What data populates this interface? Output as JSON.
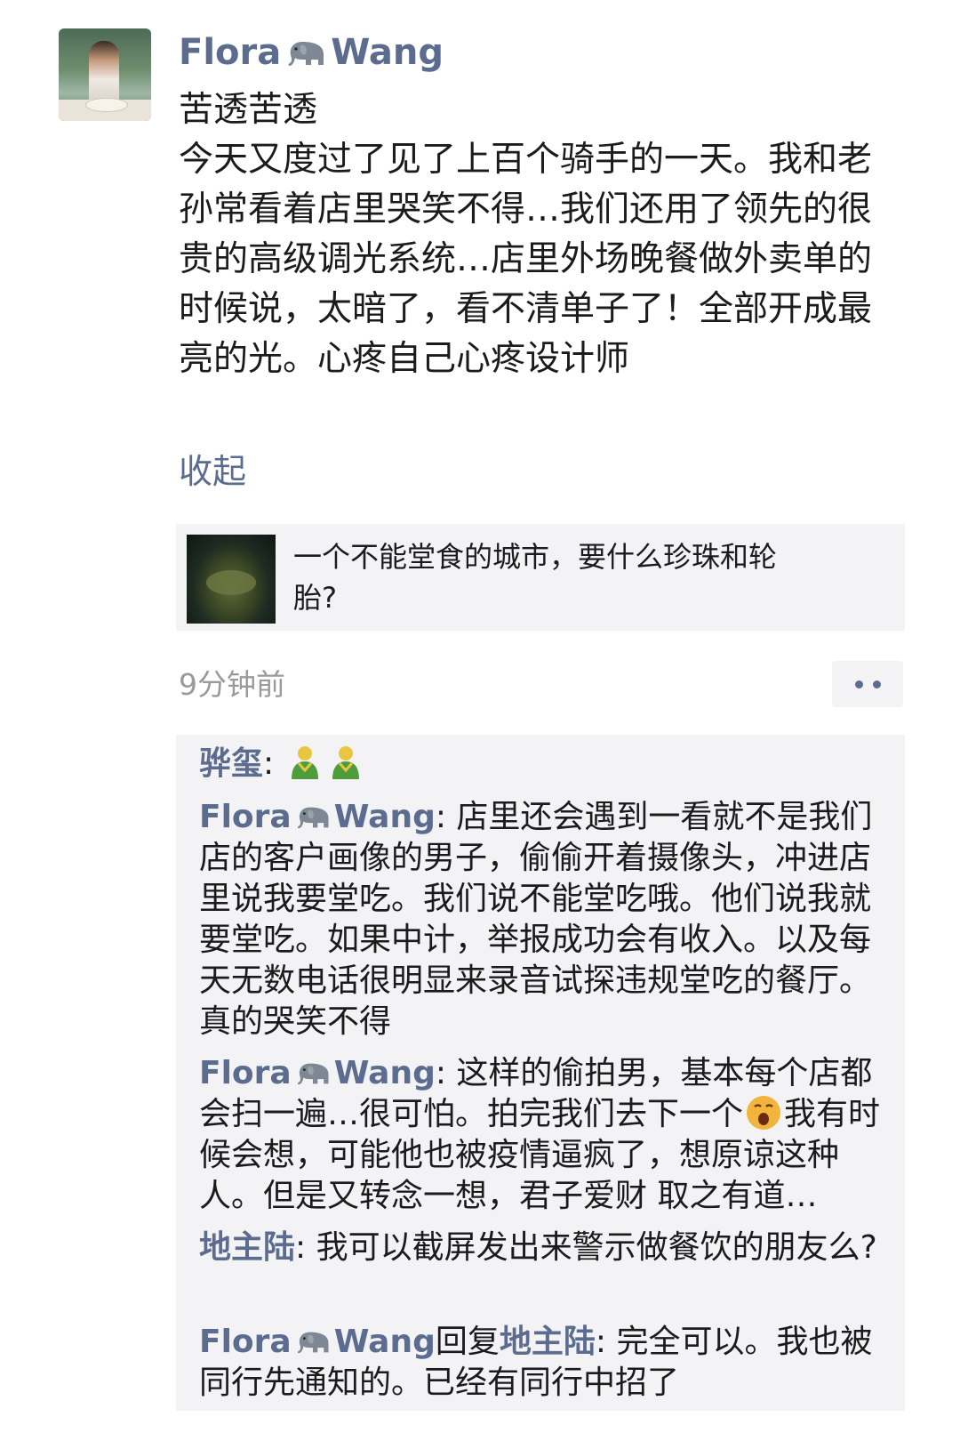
{
  "post": {
    "author_first": "Flora",
    "author_last": "Wang",
    "paragraphs": [
      "苦透苦透",
      "今天又度过了见了上百个骑手的一天。我和老孙常看着店里哭笑不得…我们还用了领先的很贵的高级调光系统…店里外场晚餐做外卖单的时候说，太暗了，看不清单子了！全部开成最亮的光。心疼自己心疼设计师"
    ],
    "collapse_label": "收起",
    "link_card": {
      "title": "一个不能堂食的城市，要什么珍珠和轮胎?"
    },
    "timestamp": "9分钟前"
  },
  "comments": [
    {
      "user": "骅玺",
      "text": ""
    },
    {
      "user_first": "Flora",
      "user_last": "Wang",
      "text": "店里还会遇到一看就不是我们店的客户画像的男子，偷偷开着摄像头，冲进店里说我要堂吃。我们说不能堂吃哦。他们说我就要堂吃。如果中计，举报成功会有收入。以及每天无数电话很明显来录音试探违规堂吃的餐厅。真的哭笑不得"
    },
    {
      "user_first": "Flora",
      "user_last": "Wang",
      "text_before": "这样的偷拍男，基本每个店都会扫一遍…很可怕。拍完我们去下一个",
      "text_after": "我有时候会想，可能他也被疫情逼疯了，想原谅这种人。但是又转念一想，君子爱财 取之有道…"
    },
    {
      "user": "地主陆",
      "text": "我可以截屏发出来警示做餐饮的朋友么?"
    },
    {
      "user_first": "Flora",
      "user_last": "Wang",
      "reply_word": "回复",
      "reply_to": "地主陆",
      "text": "完全可以。我也被同行先通知的。已经有同行中招了"
    }
  ],
  "icons": {
    "elephant": "elephant-emoji",
    "person": "person-emoji",
    "yawn": "yawning-face-emoji",
    "more": "more-dots-icon"
  },
  "colors": {
    "name_blue": "#5b6c8f",
    "panel_bg": "#f3f3f5",
    "meta_gray": "#9a9a9a"
  }
}
